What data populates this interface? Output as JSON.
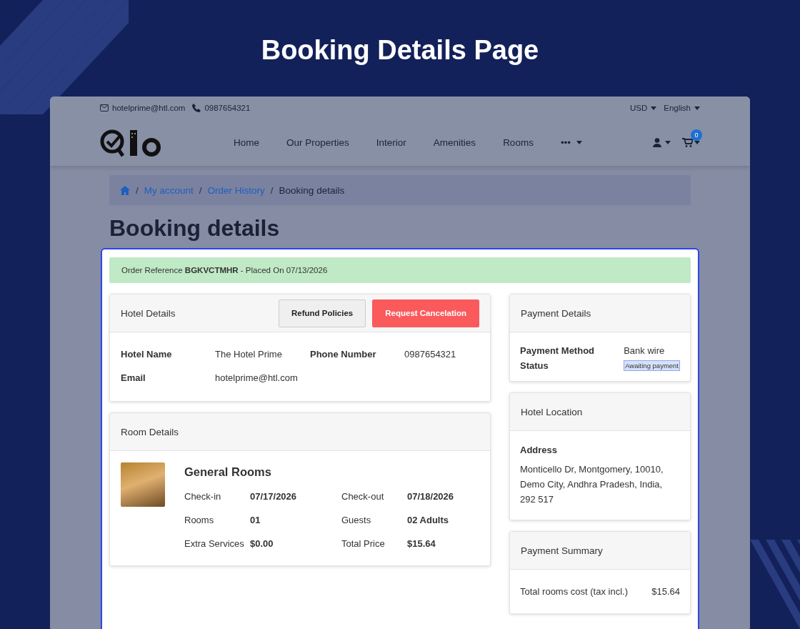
{
  "page_title": "Booking Details Page",
  "top_bar": {
    "email": "hotelprime@htl.com",
    "phone": "0987654321",
    "currency": "USD",
    "language": "English"
  },
  "nav": {
    "items": [
      {
        "label": "Home",
        "kind": "link"
      },
      {
        "label": "Our Properties",
        "kind": "link"
      },
      {
        "label": "Interior",
        "kind": "link"
      },
      {
        "label": "Amenities",
        "kind": "link"
      },
      {
        "label": "Rooms",
        "kind": "link"
      },
      {
        "label": "•••",
        "kind": "dropdown"
      }
    ],
    "cart_count": "0"
  },
  "breadcrumb_separator": "/",
  "breadcrumb": [
    {
      "label": "My account",
      "kind": "link"
    },
    {
      "label": "Order History",
      "kind": "link"
    },
    {
      "label": "Booking details",
      "kind": "current"
    }
  ],
  "heading": "Booking details",
  "order_alert": "Order Reference **BGKVCTMHR** - Placed On 07/13/2026",
  "hotel_details": {
    "title": "Hotel Details",
    "buttons": [
      {
        "label": "Refund Policies",
        "kind": "secondary"
      },
      {
        "label": "Request Cancelation",
        "kind": "danger"
      }
    ],
    "fields": [
      {
        "label": "Hotel Name",
        "value": "The Hotel Prime"
      },
      {
        "label": "Phone Number",
        "value": "0987654321"
      },
      {
        "label": "Email",
        "value": "hotelprime@htl.com"
      }
    ]
  },
  "room_details": {
    "title": "Room Details",
    "room_name": "General Rooms",
    "fields": [
      {
        "label": "Check-in",
        "value": "07/17/2026"
      },
      {
        "label": "Check-out",
        "value": "07/18/2026"
      },
      {
        "label": "Rooms",
        "value": "01"
      },
      {
        "label": "Guests",
        "value": "02 Adults"
      },
      {
        "label": "Extra Services",
        "value": "$0.00"
      },
      {
        "label": "Total Price",
        "value": "$15.64"
      }
    ]
  },
  "payment_details": {
    "title": "Payment Details",
    "method_label": "Payment Method",
    "method": "Bank wire",
    "status_label": "Status",
    "status": "Awaiting payment"
  },
  "hotel_location": {
    "title": "Hotel Location",
    "address_label": "Address",
    "address": "Monticello Dr, Montgomery, 10010, Demo City, Andhra Pradesh, India, 292 517"
  },
  "payment_summary": {
    "title": "Payment Summary",
    "rows": [
      {
        "label": "Total rooms cost (tax incl.)",
        "value": "$15.64"
      }
    ]
  }
}
